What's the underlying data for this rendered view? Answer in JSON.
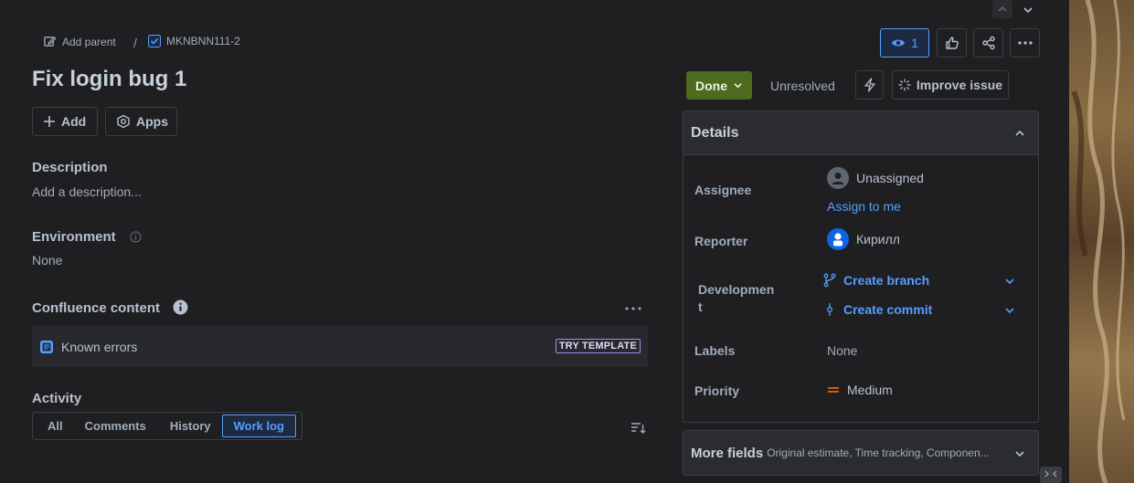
{
  "breadcrumb": {
    "add_parent": "Add parent",
    "separator": "/",
    "issue_key": "MKNBNN111-2"
  },
  "actions": {
    "watch_count": "1"
  },
  "issue": {
    "title": "Fix login bug 1"
  },
  "toolbar": {
    "add_label": "Add",
    "apps_label": "Apps"
  },
  "description": {
    "heading": "Description",
    "placeholder": "Add a description..."
  },
  "environment": {
    "heading": "Environment",
    "value": "None"
  },
  "confluence": {
    "heading": "Confluence content",
    "item_label": "Known errors",
    "try_template": "TRY TEMPLATE"
  },
  "activity": {
    "heading": "Activity",
    "tabs": [
      "All",
      "Comments",
      "History",
      "Work log"
    ],
    "active_tab": "Work log"
  },
  "status": {
    "label": "Done",
    "resolution": "Unresolved",
    "improve_label": "Improve issue",
    "color": "#4c6b1f"
  },
  "details": {
    "title": "Details",
    "assignee_label": "Assignee",
    "assignee_value": "Unassigned",
    "assign_to_me": "Assign to me",
    "reporter_label": "Reporter",
    "reporter_value": "Кирилл",
    "development_label": "Developmen t",
    "create_branch": "Create branch",
    "create_commit": "Create commit",
    "labels_label": "Labels",
    "labels_value": "None",
    "priority_label": "Priority",
    "priority_value": "Medium"
  },
  "more_fields": {
    "title": "More fields",
    "summary": "Original estimate, Time tracking, Componen..."
  },
  "colors": {
    "accent": "#579dff",
    "background": "#1f1f21",
    "priority_medium": "#e56910"
  }
}
